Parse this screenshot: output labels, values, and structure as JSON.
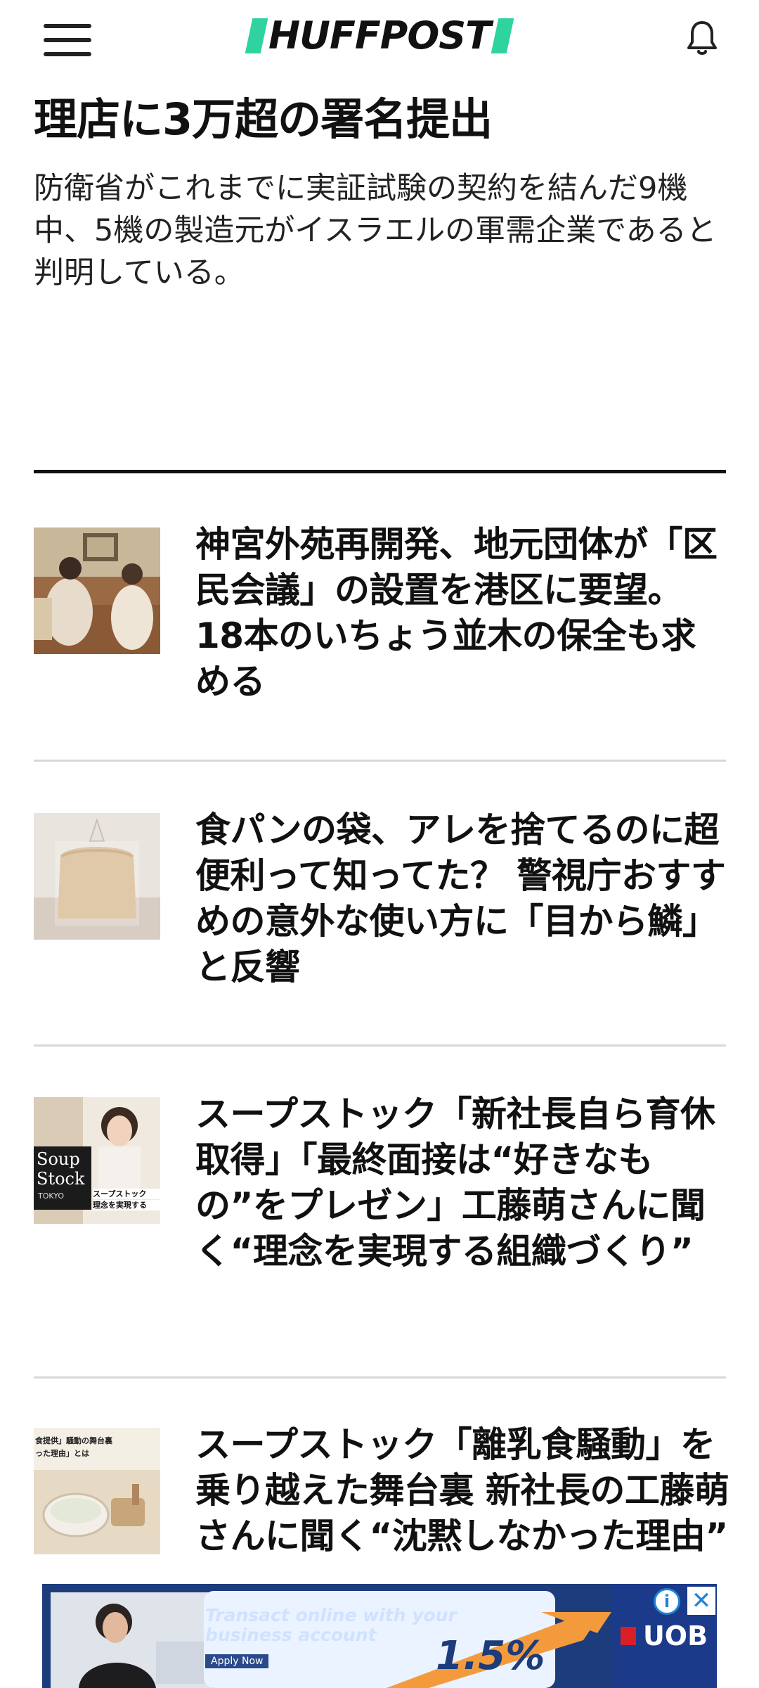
{
  "header": {
    "logo_text": "HUFFPOST",
    "menu_icon": "hamburger-menu-icon",
    "bell_icon": "notification-bell-icon",
    "brand_color": "#2ed3a0"
  },
  "lead_story": {
    "headline": "理店に3万超の署名提出",
    "dek": "防衛省がこれまでに実証試験の契約を結んだ9機中、5機の製造元がイスラエルの軍需企業であると判明している。"
  },
  "articles": [
    {
      "headline": "神宮外苑再開発、地元団体が「区民会議」の設置を港区に要望。18本のいちょう並木の保全も求める"
    },
    {
      "headline": "食パンの袋、アレを捨てるのに超便利って知ってた？ 警視庁おすすめの意外な使い方に「目から鱗」と反響"
    },
    {
      "headline": "スープストック「新社長自ら育休取得」「最終面接は“好きなもの”をプレゼン」工藤萌さんに聞く“理念を実現する組織づくり”",
      "thumb_text": [
        "Soup",
        "Stock",
        "TOKYO",
        "スープストック",
        "理念を実現する"
      ]
    },
    {
      "headline": "スープストック「離乳食騒動」を乗り越えた舞台裏 新社長の工藤萌さんに聞く“沈黙しなかった理由”",
      "thumb_text": [
        "食提供」騒動の舞台裏",
        "った理由」とは"
      ]
    }
  ],
  "ad": {
    "copy_line1": "Transact online with your",
    "copy_line2": "business account",
    "apply_label": "Apply Now",
    "rate": "1.5%",
    "brand": "UOB",
    "info_label": "i",
    "close_label": "✕"
  }
}
